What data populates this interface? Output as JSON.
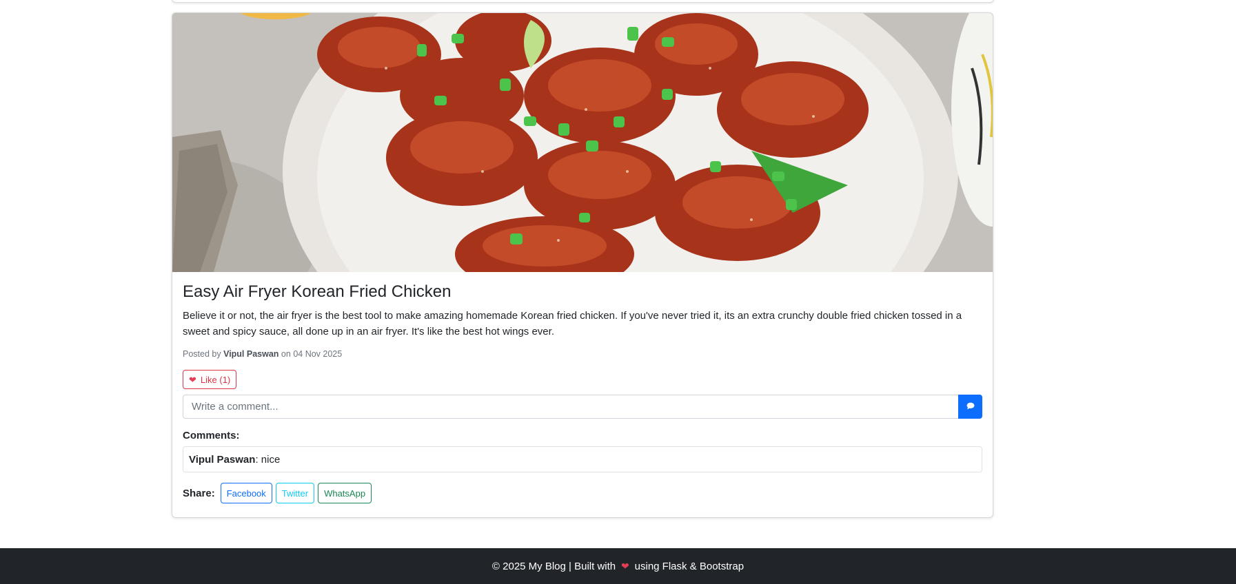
{
  "post": {
    "title": "Easy Air Fryer Korean Fried Chicken",
    "text": "Believe it or not, the air fryer is the best tool to make amazing homemade Korean fried chicken. If you've never tried it, its an extra crunchy double fried chicken tossed in a sweet and spicy sauce, all done up in an air fryer. It's like the best hot wings ever.",
    "meta_prefix": "Posted by",
    "author": "Vipul Paswan",
    "meta_on": "on",
    "date": "04 Nov 2025",
    "image_icon": "fried-chicken-photo"
  },
  "like": {
    "icon": "heart-icon",
    "label": "Like (1)"
  },
  "comment_form": {
    "placeholder": "Write a comment...",
    "submit_icon": "chat-bubble-icon"
  },
  "comments": {
    "heading": "Comments:",
    "items": [
      {
        "author": "Vipul Paswan",
        "separator": ":",
        "text": " nice"
      }
    ]
  },
  "share": {
    "label": "Share:",
    "facebook": "Facebook",
    "twitter": "Twitter",
    "whatsapp": "WhatsApp"
  },
  "footer": {
    "before": "© 2025 My Blog | Built with",
    "after": "using Flask & Bootstrap"
  },
  "colors": {
    "primary": "#0d6efd",
    "danger": "#dc3545",
    "info": "#0dcaf0",
    "success": "#198754",
    "footer_bg": "#212529"
  }
}
